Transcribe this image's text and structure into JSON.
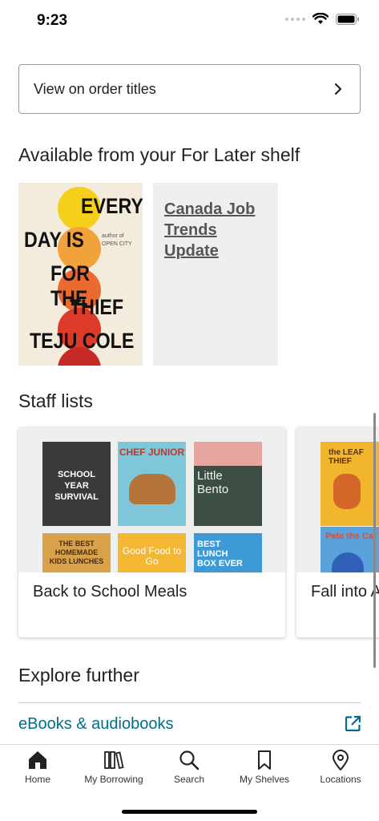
{
  "status": {
    "time": "9:23"
  },
  "order_button": {
    "label": "View on order titles"
  },
  "for_later": {
    "title": "Available from your For Later shelf",
    "books": [
      {
        "cover_lines": [
          "EVERY",
          "DAY IS",
          "FOR THE",
          "THIEF",
          "TEJU COLE"
        ],
        "cover_note": "author of OPEN CITY"
      },
      {
        "title_lines": [
          "Canada Job",
          "Trends",
          "Update"
        ]
      }
    ]
  },
  "staff_lists": {
    "title": "Staff lists",
    "cards": [
      {
        "label": "Back to School Meals",
        "covers": [
          {
            "text": "SCHOOL YEAR SURVIVAL",
            "color": "#3b3a38"
          },
          {
            "text": "CHEF JUNIOR",
            "color": "#7ec6d8"
          },
          {
            "text": "Little Bento",
            "color": "#3c4d43"
          },
          {
            "text": "THE BEST HOMEMADE KIDS LUNCHES",
            "color": "#d8a24a"
          },
          {
            "text": "Good Food to Go",
            "color": "#f4b733"
          },
          {
            "text": "BEST LUNCH BOX EVER",
            "color": "#3d9ad6"
          }
        ]
      },
      {
        "label": "Fall into A",
        "covers": [
          {
            "text": "the LEAF THIEF",
            "color": "#f1b62c"
          },
          {
            "text": "Pete the Cat",
            "color": "#5aa2dc"
          }
        ]
      }
    ]
  },
  "explore": {
    "title": "Explore further",
    "link": "eBooks & audiobooks"
  },
  "tabs": [
    {
      "label": "Home",
      "icon": "home-icon"
    },
    {
      "label": "My Borrowing",
      "icon": "books-icon"
    },
    {
      "label": "Search",
      "icon": "search-icon"
    },
    {
      "label": "My Shelves",
      "icon": "bookmark-icon"
    },
    {
      "label": "Locations",
      "icon": "location-pin-icon"
    }
  ],
  "colors": {
    "link": "#006d8f",
    "text": "#222222",
    "card_bg": "#efefef"
  }
}
